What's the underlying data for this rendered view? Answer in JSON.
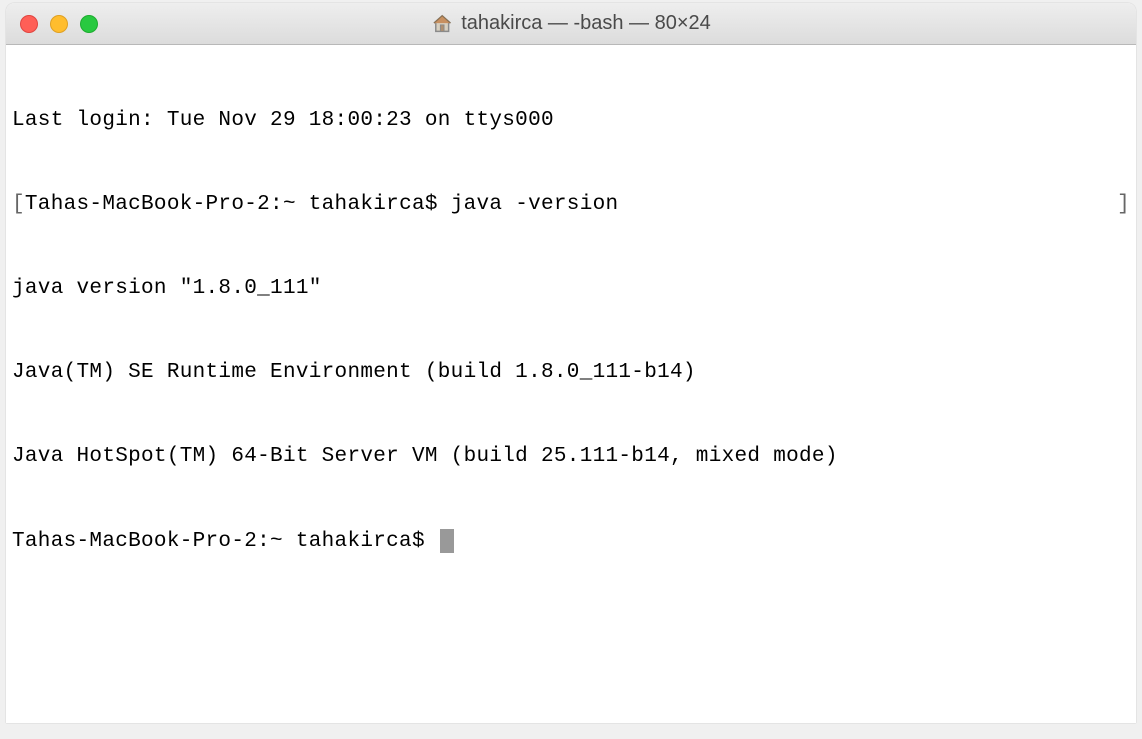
{
  "titlebar": {
    "title": "tahakirca — -bash — 80×24"
  },
  "terminal": {
    "lines": {
      "last_login": "Last login: Tue Nov 29 18:00:23 on ttys000",
      "prompt1_bracket_open": "[",
      "prompt1_host": "Tahas-MacBook-Pro-2:~ tahakirca$ ",
      "prompt1_command": "java -version",
      "prompt1_bracket_close": "]",
      "java_version": "java version \"1.8.0_111\"",
      "java_runtime": "Java(TM) SE Runtime Environment (build 1.8.0_111-b14)",
      "java_hotspot": "Java HotSpot(TM) 64-Bit Server VM (build 25.111-b14, mixed mode)",
      "prompt2": "Tahas-MacBook-Pro-2:~ tahakirca$ "
    }
  }
}
